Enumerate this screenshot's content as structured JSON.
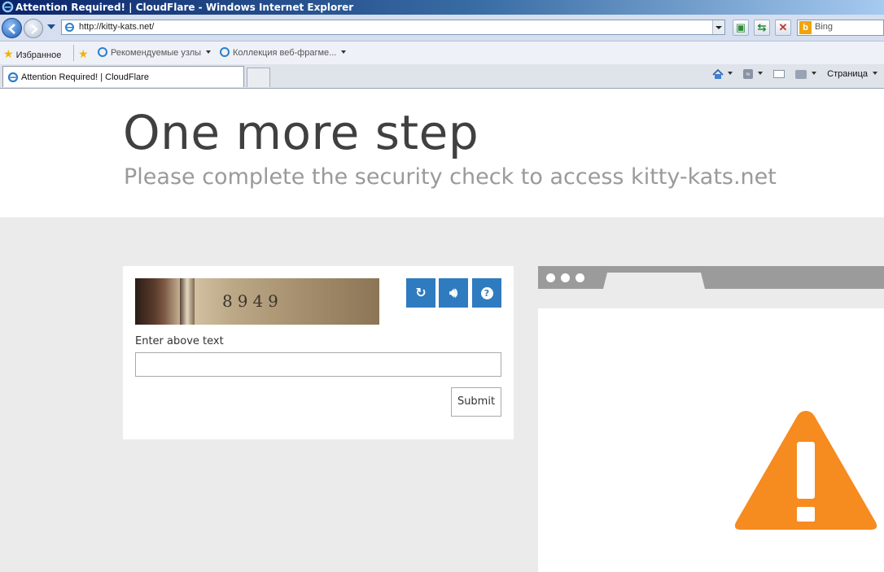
{
  "window": {
    "title": "Attention Required! | CloudFlare - Windows Internet Explorer"
  },
  "address_bar": {
    "url": "http://kitty-kats.net/"
  },
  "search": {
    "placeholder": "Bing"
  },
  "favorites_bar": {
    "favorites_label": "Избранное",
    "items": [
      "Рекомендуемые узлы",
      "Коллекция веб-фрагме..."
    ]
  },
  "tabs": [
    {
      "label": "Attention Required! | CloudFlare"
    }
  ],
  "command_bar": {
    "page_menu": "Страница"
  },
  "page": {
    "title": "One more step",
    "subtitle": "Please complete the security check to access kitty-kats.net",
    "captcha": {
      "image_text": "8949",
      "label": "Enter above text",
      "input_value": "",
      "submit_label": "Submit"
    }
  },
  "colors": {
    "accent_blue": "#2f7bbf",
    "warning_orange": "#f68b1f",
    "background_gray": "#ebebeb"
  },
  "icons": [
    "ie-logo-icon",
    "back-icon",
    "forward-icon",
    "refresh-icon",
    "stop-icon",
    "audio-icon",
    "help-icon",
    "warning-icon"
  ]
}
